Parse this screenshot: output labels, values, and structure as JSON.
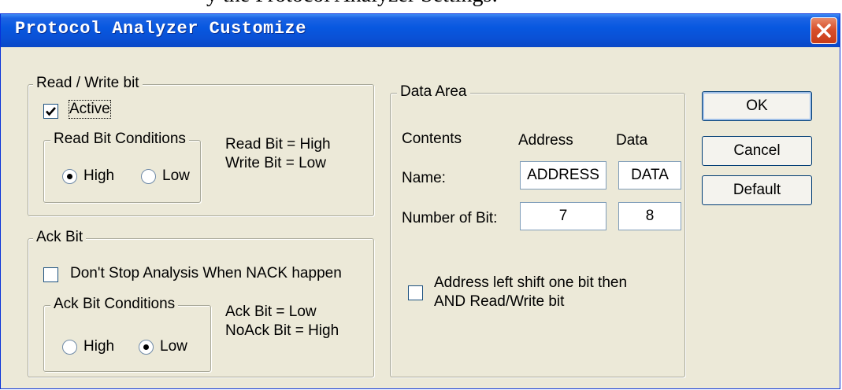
{
  "caption_fragment": "y the Protocol Analyzer Settings:",
  "window": {
    "title": "Protocol Analyzer Customize"
  },
  "rw_group": {
    "legend": "Read / Write bit",
    "active_label": "Active",
    "active_checked": true,
    "conditions_legend": "Read Bit Conditions",
    "high_label": "High",
    "low_label": "Low",
    "selected": "High",
    "note_line1": "Read Bit = High",
    "note_line2": "Write Bit = Low"
  },
  "ack_group": {
    "legend": "Ack Bit",
    "dont_stop_label": "Don't Stop Analysis When NACK happen",
    "dont_stop_checked": false,
    "conditions_legend": "Ack Bit Conditions",
    "high_label": "High",
    "low_label": "Low",
    "selected": "Low",
    "note_line1": "Ack Bit = Low",
    "note_line2": "NoAck Bit = High"
  },
  "data_area": {
    "legend": "Data Area",
    "contents_header": "Contents",
    "address_header": "Address",
    "data_header": "Data",
    "name_label": "Name:",
    "name_address_value": "ADDRESS",
    "name_data_value": "DATA",
    "bits_label": "Number of Bit:",
    "bits_address_value": "7",
    "bits_data_value": "8",
    "shift_label_line1": "Address left shift one bit then",
    "shift_label_line2": "AND Read/Write bit",
    "shift_checked": false
  },
  "buttons": {
    "ok": "OK",
    "cancel": "Cancel",
    "default": "Default"
  },
  "colors": {
    "titlebar": "#0a50d4",
    "dialog_bg": "#ece9d8",
    "close": "#d8502c"
  },
  "icons": {
    "close": "close-icon",
    "check": "check-icon"
  }
}
